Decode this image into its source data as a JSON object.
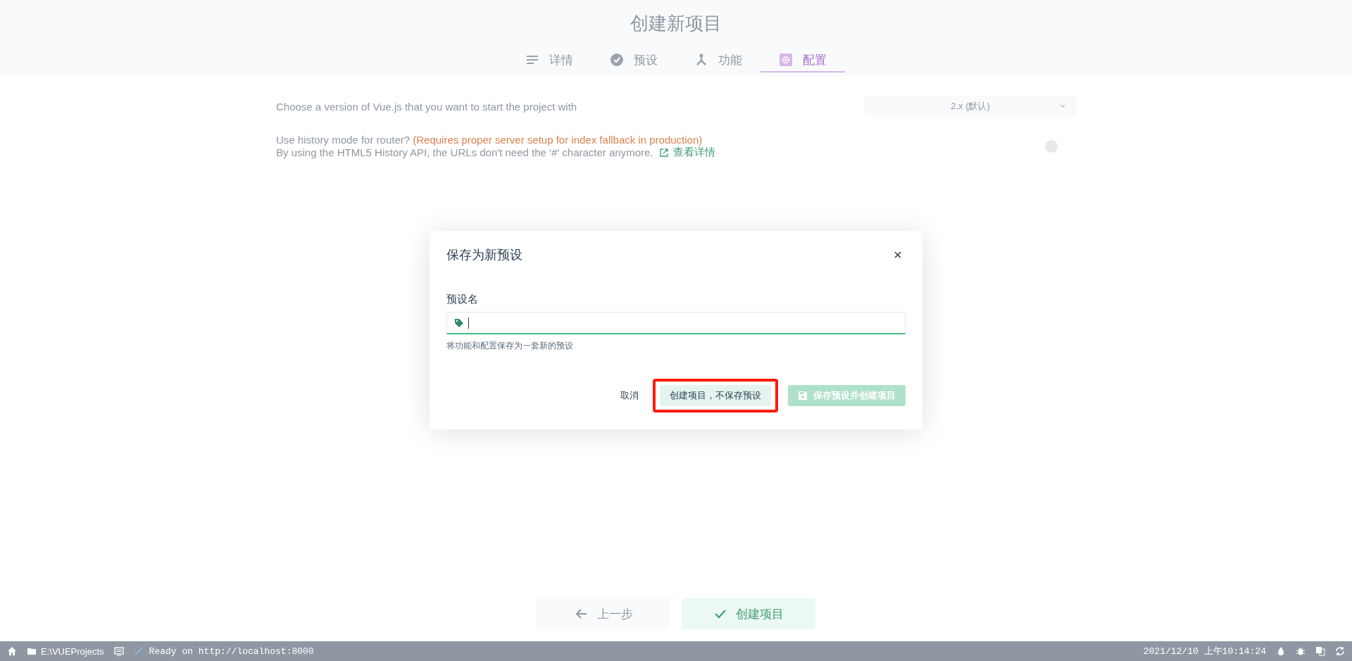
{
  "header": {
    "title": "创建新项目"
  },
  "tabs": [
    {
      "label": "详情",
      "selected": false
    },
    {
      "label": "预设",
      "selected": false
    },
    {
      "label": "功能",
      "selected": false
    },
    {
      "label": "配置",
      "selected": true
    }
  ],
  "settings": [
    {
      "kind": "select",
      "label": "Choose a version of Vue.js that you want to start the project with",
      "value": "2.x (默认)"
    },
    {
      "kind": "toggle",
      "label": "Use history mode for router?",
      "warning": "(Requires proper server setup for index fallback in production)",
      "description": "By using the HTML5 History API, the URLs don't need the '#' character anymore.",
      "link": "查看详情",
      "on": false
    }
  ],
  "footer_buttons": [
    {
      "label": "上一步",
      "kind": "back"
    },
    {
      "label": "创建项目",
      "kind": "create"
    }
  ],
  "dialog": {
    "title": "保存为新预设",
    "field_label": "预设名",
    "hint": "将功能和配置保存为一套新的预设",
    "buttons": [
      {
        "label": "取消",
        "kind": "flat",
        "disabled": false,
        "highlighted": false
      },
      {
        "label": "创建项目，不保存预设",
        "kind": "light",
        "disabled": false,
        "highlighted": true
      },
      {
        "label": "保存预设并创建项目",
        "kind": "primary",
        "disabled": true,
        "highlighted": false
      }
    ]
  },
  "status_bar": {
    "path": "E:\\VUEProjects",
    "log": "Ready on http://localhost:8000",
    "time": "2021/12/10 上午10:14:24"
  }
}
